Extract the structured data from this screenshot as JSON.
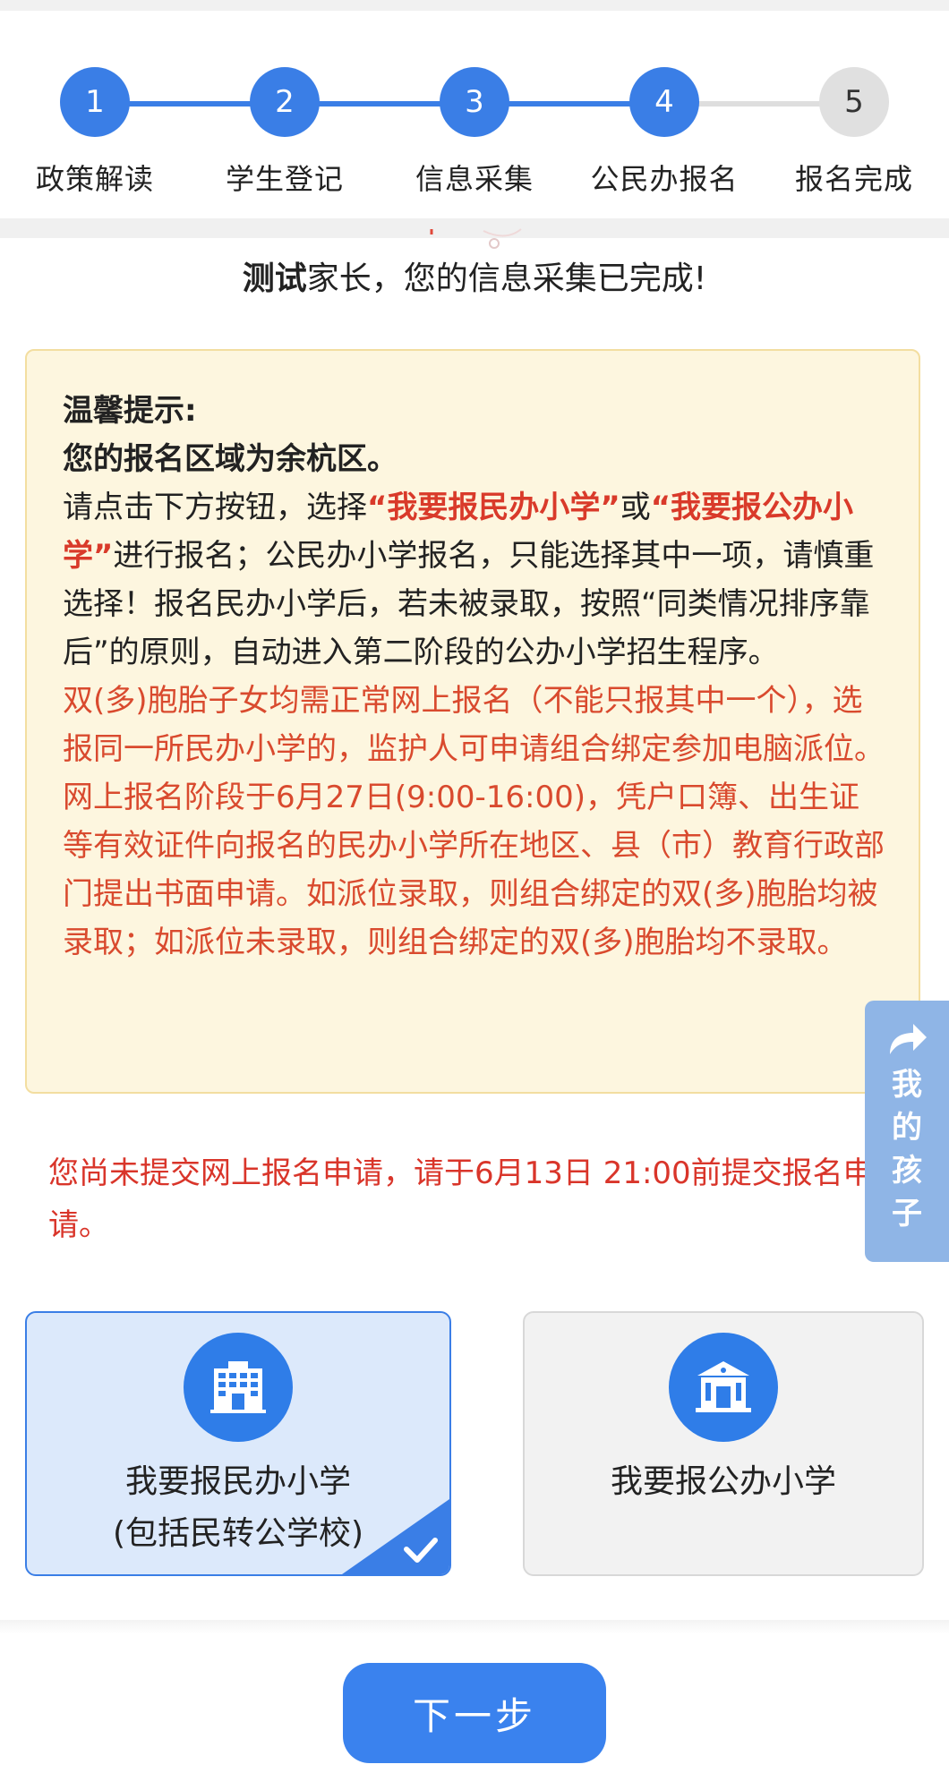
{
  "stepper": {
    "steps": [
      {
        "number": "1",
        "label": "政策解读",
        "status": "done"
      },
      {
        "number": "2",
        "label": "学生登记",
        "status": "done"
      },
      {
        "number": "3",
        "label": "信息采集",
        "status": "done"
      },
      {
        "number": "4",
        "label": "公民办报名",
        "status": "current"
      },
      {
        "number": "5",
        "label": "报名完成",
        "status": "todo"
      }
    ]
  },
  "greeting": {
    "name": "测试",
    "text": "家长，您的信息采集已完成!"
  },
  "notice": {
    "title": "温馨提示:",
    "region_line": "您的报名区域为余杭区。",
    "p1_a": "请点击下方按钮，选择",
    "p1_opt1": "“我要报民办小学”",
    "p1_or": "或",
    "p1_opt2": "“我要报公办小学”",
    "p1_b": "进行报名；公民办小学报名，只能选择其中一项，请慎重选择！报名民办小学后，若未被录取，按照“同类情况排序靠后”的原则，自动进入第二阶段的公办小学招生程序。",
    "twins": "双(多)胞胎子女均需正常网上报名（不能只报其中一个），选报同一所民办小学的，监护人可申请组合绑定参加电脑派位。网上报名阶段于6月27日(9:00-16:00)，凭户口簿、出生证等有效证件向报名的民办小学所在地区、县（市）教育行政部门提出书面申请。如派位录取，则组合绑定的双(多)胞胎均被录取；如派位未录取，则组合绑定的双(多)胞胎均不录取。"
  },
  "reminder": "您尚未提交网上报名申请，请于6月13日 21:00前提交报名申请。",
  "float_tab": {
    "label": "我的孩子",
    "icon": "share-arrow-icon"
  },
  "options": {
    "private": {
      "line1": "我要报民办小学",
      "line2": "(包括民转公学校)",
      "selected": true,
      "icon": "office-building-icon"
    },
    "public": {
      "line1": "我要报公办小学",
      "selected": false,
      "icon": "school-building-icon"
    }
  },
  "next_button": "下一步",
  "colors": {
    "primary": "#3a7ee6",
    "notice_bg": "#fdf6df",
    "warning_red": "#d9352a",
    "float_tab": "#8fb5e6"
  }
}
